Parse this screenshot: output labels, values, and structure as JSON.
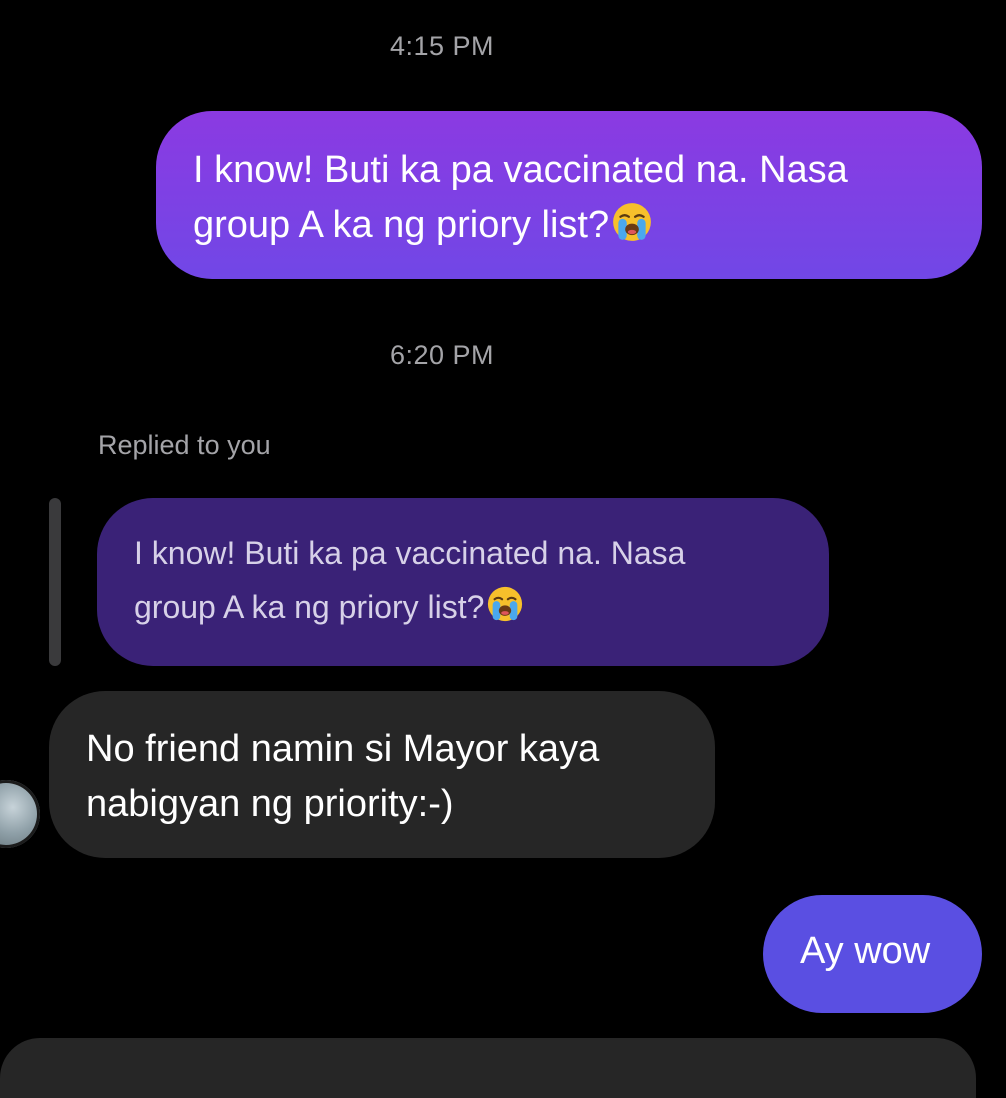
{
  "thread": {
    "timestamp_1": "4:15 PM",
    "timestamp_2": "6:20 PM",
    "replied_label": "Replied to you"
  },
  "messages": [
    {
      "sender": "me",
      "line1": "I know! Buti ka pa vaccinated na. Nasa",
      "line2": "group A ka ng priory list?",
      "emoji": "loudly-crying-face-icon"
    },
    {
      "sender": "them",
      "quoted_line1": "I know! Buti ka pa vaccinated na. Nasa",
      "quoted_line2": "group A ka ng priory list?",
      "quoted_emoji": "loudly-crying-face-icon",
      "line1": "No friend namin si Mayor kaya",
      "line2": "nabigyan ng priority:-)"
    },
    {
      "sender": "me",
      "line1": "Ay wow"
    }
  ],
  "colors": {
    "background": "#000000",
    "outgoing_gradient_top": "#8b3ae2",
    "outgoing_gradient_bottom": "#7147e6",
    "outgoing_latest": "#5a4fe2",
    "incoming": "#262626",
    "quoted_reply": "#3a2277",
    "meta_text": "#a4a4a8"
  }
}
